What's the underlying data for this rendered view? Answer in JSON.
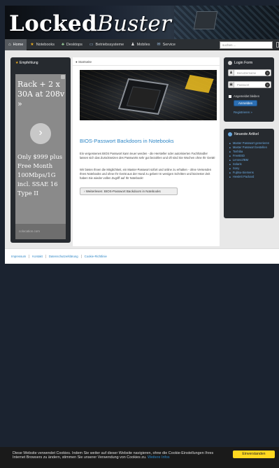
{
  "site": {
    "logo_bold": "Locked",
    "logo_italic": "Buster"
  },
  "nav": {
    "items": [
      {
        "label": "Home",
        "icon": "home-icon"
      },
      {
        "label": "Notebooks",
        "icon": "star-icon"
      },
      {
        "label": "Desktops",
        "icon": "people-icon"
      },
      {
        "label": "Betriebssysteme",
        "icon": "monitor-icon"
      },
      {
        "label": "Mobiles",
        "icon": "person-icon"
      },
      {
        "label": "Service",
        "icon": "envelope-icon"
      }
    ],
    "search_placeholder": "suchen ..."
  },
  "left": {
    "title": "Empfehlung",
    "ad": {
      "headline": "Rack + 2 x 30A at 208v »",
      "body": "Only $999 plus Free Month 100Mbps/1G incl. SSAE 16 Type II",
      "url": "colocation.com"
    }
  },
  "breadcrumb": "Startseite",
  "article": {
    "title": "BIOS-Passwort Backdoors in Notebooks",
    "p1": "Ein vergessenes BIOS Passwort kann teuer werden - die Hersteller oder autorisierten Fachhändler lassen sich das Zurücksetzen des Passworts sehr gut bezahlen und oft sind Sie Wochen ohne Ihr Gerät!",
    "p2": "Wir bieten Ihnen die Möglichkeit, ein Master-Passwort sofort und online zu erhalten - ohne Versenden Ihres Notebooks und ohne Ihr Gerät aus der Hand zu geben! In wenigen Schritten und kürzester Zeit haben Sie wieder vollen Zugriff auf Ihr Notebook!",
    "more_label": "Weiterlesen: BIOS-Passwort Backdoors in Notebooks"
  },
  "login": {
    "title": "Login Form",
    "username_placeholder": "Benutzername",
    "password_placeholder": "Passwort",
    "remember_label": "Angemeldet bleiben",
    "button_label": "Anmelden",
    "register_label": "Registrieren »"
  },
  "newest": {
    "title": "Neueste Artikel",
    "items": [
      "Master Passwort generieren",
      "Master Passwort bestellen",
      "Toshiba",
      "FreeBSD",
      "Lenovo/IBM",
      "Solaris",
      "Sony",
      "Fujitsu-Siemens",
      "Hewlett Packard"
    ]
  },
  "footer": {
    "links": [
      "Impressum",
      "Kontakt",
      "Datenschutzerklärung",
      "Cookie-Richtlinie"
    ]
  },
  "cookie": {
    "text": "Diese Website verwendet Cookies. Indem Sie weiter auf dieser Website navigieren, ohne die Cookie-Einstellungen Ihres Internet Browsers zu ändern, stimmen Sie unserer Verwendung von Cookies zu.",
    "link": "Weitere Infos",
    "button": "Einverstanden"
  },
  "colors": {
    "accent": "#2d86c6",
    "dark_box": "#262a2f",
    "cookie_button": "#ffd820",
    "background": "#1b2330"
  }
}
